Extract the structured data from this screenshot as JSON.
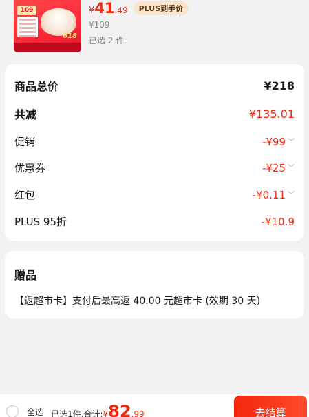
{
  "product": {
    "price_currency": "¥",
    "price_int": "41",
    "price_dec": ".49",
    "plus_badge": "PLUS到手价",
    "original_price": "¥109",
    "selected_count": "已选 2 件",
    "thumb_tag": "109",
    "thumb_618": "618"
  },
  "summary": {
    "total_label": "商品总价",
    "total_value": "¥218",
    "discount_label": "共减",
    "discount_value": "¥135.01",
    "promo_label": "促销",
    "promo_value": "-¥99",
    "coupon_label": "优惠券",
    "coupon_value": "-¥25",
    "redpacket_label": "红包",
    "redpacket_value": "-¥0.11",
    "plus_label": "PLUS 95折",
    "plus_value": "-¥10.9"
  },
  "gift": {
    "title": "赠品",
    "text": "【返超市卡】支付后最高返 40.00 元超市卡 (效期 30 天)"
  },
  "bottom": {
    "select_all": "全选",
    "count_text": "已选1件,合计:",
    "total_currency": "¥",
    "total_int": "82",
    "total_dec": ".99",
    "checkout_label": "去结算"
  },
  "colors": {
    "accent": "#f2270c",
    "background": "#f2f2f2"
  }
}
